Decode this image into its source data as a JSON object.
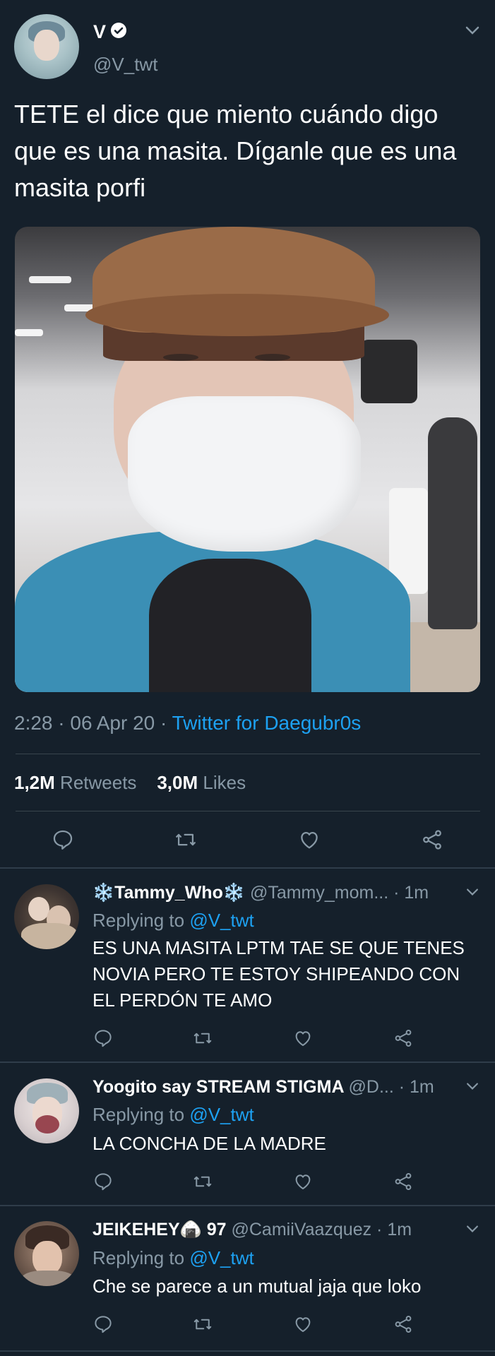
{
  "tweet": {
    "name": "V",
    "handle": "@V_twt",
    "text": "TETE el dice que miento cuándo digo que es una masita. Díganle que es una masita porfi",
    "time": "2:28 · 06 Apr 20 · ",
    "source": "Twitter for Daegubr0s",
    "retweets_count": "1,2M",
    "retweets_label": "Retweets",
    "likes_count": "3,0M",
    "likes_label": "Likes"
  },
  "replies": [
    {
      "name": "❄️Tammy_Who❄️",
      "handle": "@Tammy_mom...",
      "time": " · 1m",
      "replying_prefix": "Replying to ",
      "replying_to": "@V_twt",
      "text": "ES UNA MASITA LPTM TAE SE QUE TENES NOVIA PERO TE ESTOY SHIPEANDO CON EL PERDÓN TE AMO"
    },
    {
      "name": "Yoogito say STREAM STIGMA",
      "handle": "@D...",
      "time": " · 1m",
      "replying_prefix": "Replying to ",
      "replying_to": "@V_twt",
      "text": "LA CONCHA DE LA MADRE"
    },
    {
      "name": "JEIKEHEY🍙 97",
      "handle": "@CamiiVaazquez",
      "time": " · 1m",
      "replying_prefix": "Replying to ",
      "replying_to": "@V_twt",
      "text": "Che se parece a un mutual jaja que loko"
    }
  ],
  "colors": {
    "background": "#15202b",
    "muted": "#8899a6",
    "accent": "#1da1f2",
    "divider": "#38444d"
  },
  "icons": [
    "verified-icon",
    "chevron-down-icon",
    "reply-icon",
    "retweet-icon",
    "like-icon",
    "share-icon"
  ]
}
